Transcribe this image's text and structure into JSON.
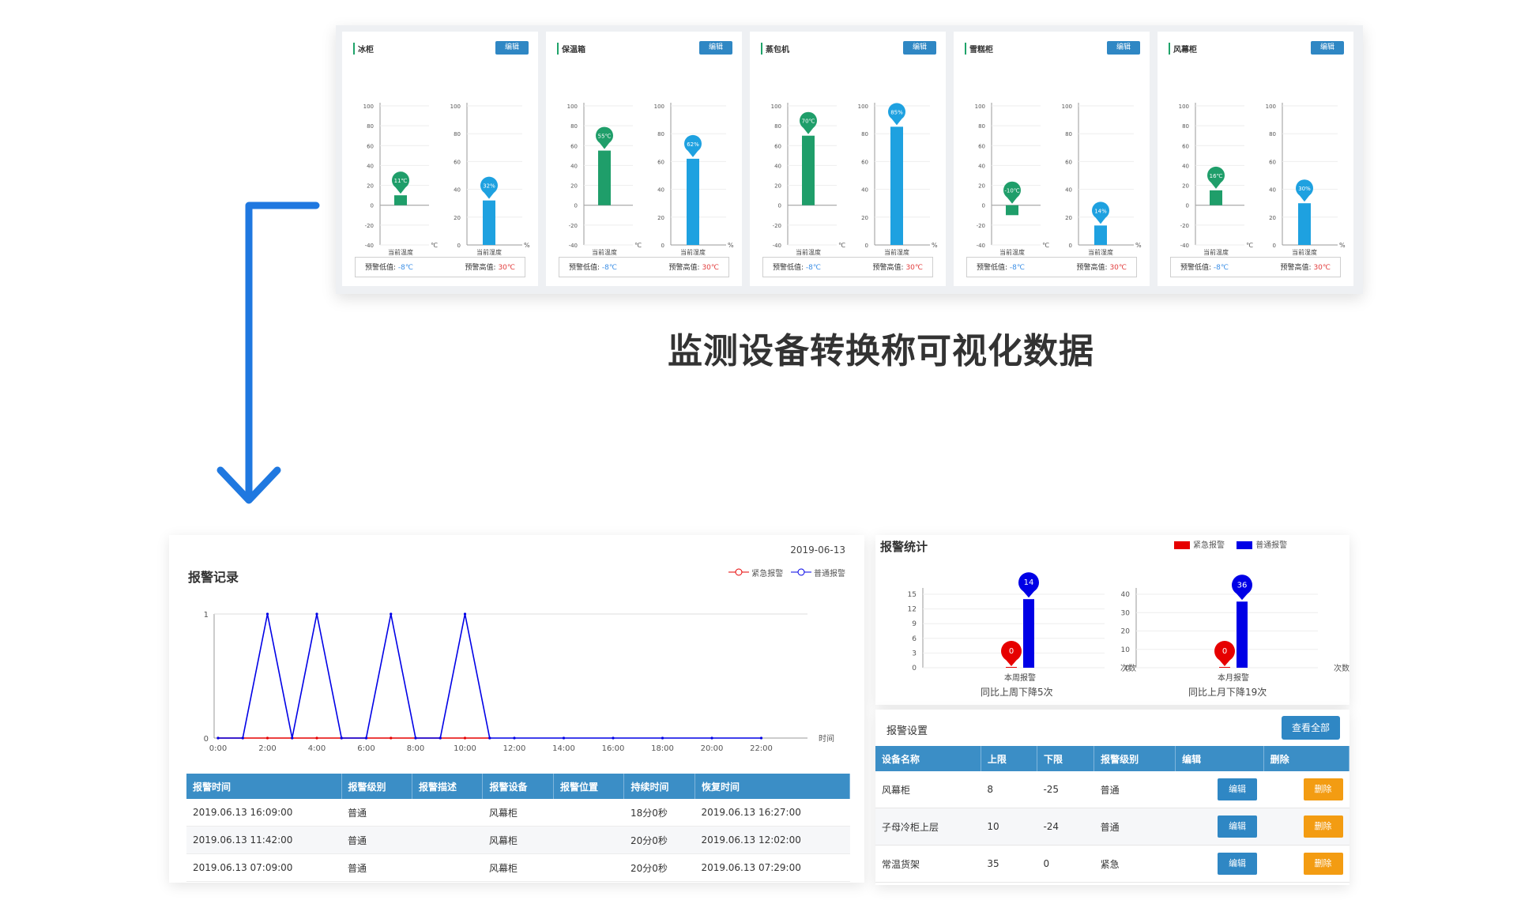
{
  "caption": "监测设备转换称可视化数据",
  "colors": {
    "green": "#1f9e6a",
    "blue": "#1ea1e0",
    "red": "#e60000",
    "deep_blue": "#0000e6",
    "header": "#3b8ec6"
  },
  "card_common": {
    "edit_label": "编辑",
    "temp_axis": [
      "100",
      "80",
      "60",
      "40",
      "20",
      "0",
      "-20",
      "-40"
    ],
    "hum_axis": [
      "100",
      "80",
      "60",
      "40",
      "20",
      "0"
    ],
    "temp_unit": "℃",
    "hum_unit": "%",
    "temp_xlabel": "当前温度",
    "hum_xlabel": "当前湿度",
    "alarm_low_label": "预警低值:",
    "alarm_low_value": "-8℃",
    "alarm_high_label": "预警高值:",
    "alarm_high_value": "30℃"
  },
  "cards": [
    {
      "name": "冰柜",
      "temp": 10,
      "temp_label": "11℃",
      "hum": 32,
      "hum_label": "32%"
    },
    {
      "name": "保温箱",
      "temp": 55,
      "temp_label": "55℃",
      "hum": 62,
      "hum_label": "62%"
    },
    {
      "name": "蒸包机",
      "temp": 70,
      "temp_label": "70℃",
      "hum": 85,
      "hum_label": "85%"
    },
    {
      "name": "雪糕柜",
      "temp": -10,
      "temp_label": "-10℃",
      "hum": 14,
      "hum_label": "14%"
    },
    {
      "name": "风幕柜",
      "temp": 15,
      "temp_label": "16℃",
      "hum": 30,
      "hum_label": "30%"
    }
  ],
  "record": {
    "title": "报警记录",
    "date": "2019-06-13",
    "legend_urgent": "紧急报警",
    "legend_normal": "普通报警",
    "x_unit": "时间",
    "chart_data": {
      "type": "line",
      "x": [
        "0:00",
        "2:00",
        "4:00",
        "6:00",
        "8:00",
        "10:00",
        "12:00",
        "14:00",
        "16:00",
        "18:00",
        "20:00",
        "22:00"
      ],
      "ylim": [
        0,
        1
      ],
      "yticks": [
        "0",
        "1"
      ],
      "series": [
        {
          "name": "紧急报警",
          "points": [
            [
              0,
              0
            ],
            [
              1,
              0
            ],
            [
              2,
              0
            ],
            [
              3,
              0
            ],
            [
              4,
              0
            ],
            [
              5,
              0
            ],
            [
              6,
              0
            ],
            [
              7,
              0
            ],
            [
              8,
              0
            ],
            [
              9,
              0
            ],
            [
              10,
              0
            ],
            [
              11,
              0
            ]
          ]
        },
        {
          "name": "普通报警",
          "points": [
            [
              0,
              0
            ],
            [
              1,
              0
            ],
            [
              2,
              1
            ],
            [
              3,
              0
            ],
            [
              4,
              1
            ],
            [
              5,
              0
            ],
            [
              6,
              0
            ],
            [
              7,
              1
            ],
            [
              8,
              0
            ],
            [
              9,
              0
            ],
            [
              10,
              1
            ],
            [
              11,
              0
            ],
            [
              12,
              0
            ],
            [
              14,
              0
            ],
            [
              16,
              0
            ],
            [
              18,
              0
            ],
            [
              20,
              0
            ],
            [
              22,
              0
            ]
          ]
        }
      ]
    },
    "table": {
      "headers": [
        "报警时间",
        "报警级别",
        "报警描述",
        "报警设备",
        "报警位置",
        "持续时间",
        "恢复时间"
      ],
      "rows": [
        [
          "2019.06.13 16:09:00",
          "普通",
          "",
          "风幕柜",
          "",
          "18分0秒",
          "2019.06.13 16:27:00"
        ],
        [
          "2019.06.13 11:42:00",
          "普通",
          "",
          "风幕柜",
          "",
          "20分0秒",
          "2019.06.13 12:02:00"
        ],
        [
          "2019.06.13 07:09:00",
          "普通",
          "",
          "风幕柜",
          "",
          "20分0秒",
          "2019.06.13 07:29:00"
        ]
      ]
    }
  },
  "stats": {
    "title": "报警统计",
    "legend_urgent": "紧急报警",
    "legend_normal": "普通报警",
    "x_unit": "次数",
    "chart_data": [
      {
        "type": "bar",
        "category": "本周报警",
        "yticks": [
          "0",
          "3",
          "6",
          "9",
          "12",
          "15"
        ],
        "ylim": [
          0,
          15
        ],
        "urgent": 0,
        "normal": 14
      },
      {
        "type": "bar",
        "category": "本月报警",
        "yticks": [
          "0",
          "10",
          "20",
          "30",
          "40"
        ],
        "ylim": [
          0,
          40
        ],
        "urgent": 0,
        "normal": 36
      }
    ],
    "week_note": "同比上周下降5次",
    "month_note": "同比上月下降19次"
  },
  "settings": {
    "title": "报警设置",
    "view_all": "查看全部",
    "headers": [
      "设备名称",
      "上限",
      "下限",
      "报警级别",
      "编辑",
      "删除"
    ],
    "edit_label": "编辑",
    "delete_label": "删除",
    "rows": [
      [
        "风幕柜",
        "8",
        "-25",
        "普通"
      ],
      [
        "子母冷柜上层",
        "10",
        "-24",
        "普通"
      ],
      [
        "常温货架",
        "35",
        "0",
        "紧急"
      ]
    ]
  }
}
